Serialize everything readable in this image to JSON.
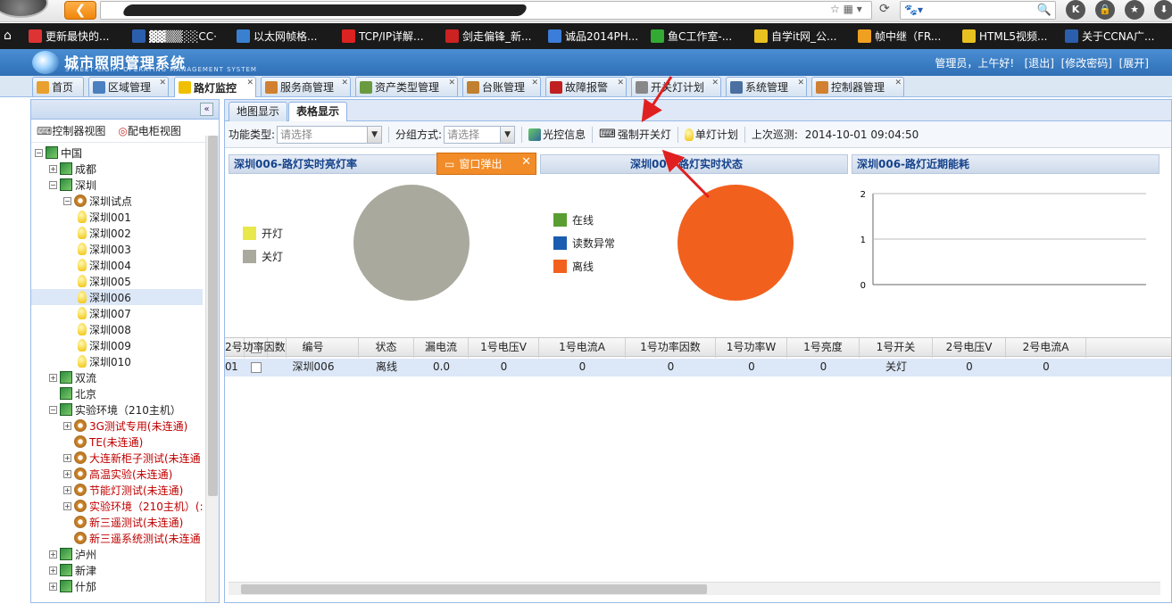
{
  "browser": {
    "bookmarks": [
      {
        "label": "更新最快的...",
        "color": "#d33"
      },
      {
        "label": "▓▓▒▒░░CC·",
        "color": "#2b5fae"
      },
      {
        "label": "以太网帧格...",
        "color": "#3a80d0"
      },
      {
        "label": "TCP/IP详解...",
        "color": "#d22"
      },
      {
        "label": "剑走偏锋_新...",
        "color": "#c22"
      },
      {
        "label": "诚品2014PH...",
        "color": "#3b7dd8"
      },
      {
        "label": "鱼C工作室-...",
        "color": "#3a3"
      },
      {
        "label": "自学it网_公...",
        "color": "#e8c020"
      },
      {
        "label": "帧中继（FR...",
        "color": "#f0a020"
      },
      {
        "label": "HTML5视频...",
        "color": "#e8c020"
      },
      {
        "label": "关于CCNA广...",
        "color": "#2b5fae"
      }
    ],
    "right_icons": [
      "K",
      "🔒",
      "★",
      "⬇"
    ]
  },
  "header": {
    "title": "城市照明管理系统",
    "subtitle": "STREET LIGHT OPERATING MANAGEMENT SYSTEM",
    "greeting": "管理员，上午好!",
    "links": [
      "[退出]",
      "[修改密码]",
      "[展开]"
    ]
  },
  "tabs": [
    {
      "label": "首页",
      "color": "#e8a030"
    },
    {
      "label": "区域管理",
      "color": "#4a7fc0"
    },
    {
      "label": "路灯监控",
      "color": "#f0c000"
    },
    {
      "label": "服务商管理",
      "color": "#d08030"
    },
    {
      "label": "资产类型管理",
      "color": "#6a9a40"
    },
    {
      "label": "台账管理",
      "color": "#c08030"
    },
    {
      "label": "故障报警",
      "color": "#c02020"
    },
    {
      "label": "开关灯计划",
      "color": "#888"
    },
    {
      "label": "系统管理",
      "color": "#4a6fa0"
    },
    {
      "label": "控制器管理",
      "color": "#d08030"
    }
  ],
  "sidebar": {
    "views": [
      "控制器视图",
      "配电柜视图"
    ],
    "tree": [
      {
        "label": "中国",
        "level": 0,
        "icon": "map",
        "exp": "-"
      },
      {
        "label": "成都",
        "level": 1,
        "icon": "map",
        "exp": "+"
      },
      {
        "label": "深圳",
        "level": 1,
        "icon": "map",
        "exp": "-"
      },
      {
        "label": "深圳试点",
        "level": 2,
        "icon": "gear",
        "exp": "-"
      },
      {
        "label": "深圳001",
        "level": 3,
        "icon": "bulb",
        "exp": ""
      },
      {
        "label": "深圳002",
        "level": 3,
        "icon": "bulb",
        "exp": ""
      },
      {
        "label": "深圳003",
        "level": 3,
        "icon": "bulb",
        "exp": ""
      },
      {
        "label": "深圳004",
        "level": 3,
        "icon": "bulb",
        "exp": ""
      },
      {
        "label": "深圳005",
        "level": 3,
        "icon": "bulb",
        "exp": ""
      },
      {
        "label": "深圳006",
        "level": 3,
        "icon": "bulb",
        "exp": "",
        "selected": true
      },
      {
        "label": "深圳007",
        "level": 3,
        "icon": "bulb",
        "exp": ""
      },
      {
        "label": "深圳008",
        "level": 3,
        "icon": "bulb",
        "exp": ""
      },
      {
        "label": "深圳009",
        "level": 3,
        "icon": "bulb",
        "exp": ""
      },
      {
        "label": "深圳010",
        "level": 3,
        "icon": "bulb",
        "exp": ""
      },
      {
        "label": "双流",
        "level": 1,
        "icon": "map",
        "exp": "+"
      },
      {
        "label": "北京",
        "level": 1,
        "icon": "map",
        "exp": ""
      },
      {
        "label": "实验环境（210主机）",
        "level": 1,
        "icon": "map",
        "exp": "-"
      },
      {
        "label": "3G测试专用(未连通)",
        "level": 2,
        "icon": "gear",
        "exp": "+",
        "red": true
      },
      {
        "label": "TE(未连通)",
        "level": 2,
        "icon": "gear",
        "exp": "",
        "red": true
      },
      {
        "label": "大连新柜子测试(未连通",
        "level": 2,
        "icon": "gear",
        "exp": "+",
        "red": true
      },
      {
        "label": "高温实验(未连通)",
        "level": 2,
        "icon": "gear",
        "exp": "+",
        "red": true
      },
      {
        "label": "节能灯测试(未连通)",
        "level": 2,
        "icon": "gear",
        "exp": "+",
        "red": true
      },
      {
        "label": "实验环境（210主机）(:",
        "level": 2,
        "icon": "gear",
        "exp": "+",
        "red": true
      },
      {
        "label": "新三遥测试(未连通)",
        "level": 2,
        "icon": "gear",
        "exp": "",
        "red": true
      },
      {
        "label": "新三遥系统测试(未连通",
        "level": 2,
        "icon": "gear",
        "exp": "",
        "red": true
      },
      {
        "label": "泸州",
        "level": 1,
        "icon": "map",
        "exp": "+"
      },
      {
        "label": "新津",
        "level": 1,
        "icon": "map",
        "exp": "+"
      },
      {
        "label": "什邡",
        "level": 1,
        "icon": "map",
        "exp": "+"
      }
    ]
  },
  "main": {
    "subtabs": [
      "地图显示",
      "表格显示"
    ],
    "toolbar": {
      "func_label": "功能类型:",
      "func_placeholder": "请选择",
      "group_label": "分组方式:",
      "group_placeholder": "请选择",
      "btn_light_ctrl": "光控信息",
      "btn_force_switch": "强制开关灯",
      "btn_single_plan": "单灯计划",
      "last_patrol_label": "上次巡测:",
      "last_patrol_time": "2014-10-01 09:04:50"
    },
    "popup_label": "窗口弹出",
    "panels": [
      {
        "title": "深圳006-路灯实时亮灯率"
      },
      {
        "title": "深圳006-路灯实时状态"
      },
      {
        "title": "深圳006-路灯近期能耗"
      }
    ],
    "grid": {
      "columns": [
        "编号",
        "状态",
        "漏电流",
        "1号电压V",
        "1号电流A",
        "1号功率因数",
        "1号功率W",
        "1号亮度",
        "1号开关",
        "2号电压V",
        "2号电流A",
        "2号功率因数"
      ],
      "rows": [
        {
          "num": "1",
          "cells": [
            "深圳006",
            "离线",
            "0.0",
            "0",
            "0",
            "0",
            "0",
            "0",
            "关灯",
            "0",
            "0",
            "0"
          ]
        }
      ]
    }
  },
  "chart_data": [
    {
      "type": "pie",
      "labels": [
        "开灯",
        "关灯"
      ],
      "values": [
        0,
        100
      ],
      "colors": [
        "#e8e84a",
        "#a9aa9d"
      ],
      "legend": "left"
    },
    {
      "type": "pie",
      "labels": [
        "在线",
        "读数异常",
        "离线"
      ],
      "values": [
        0,
        0,
        100
      ],
      "colors": [
        "#5a9e32",
        "#1a5cb0",
        "#f2601e"
      ],
      "legend": "left"
    },
    {
      "type": "line",
      "x": [],
      "series": [],
      "ylim": [
        0,
        2
      ],
      "yticks": [
        "0",
        "1",
        "2"
      ],
      "grid": true
    }
  ]
}
